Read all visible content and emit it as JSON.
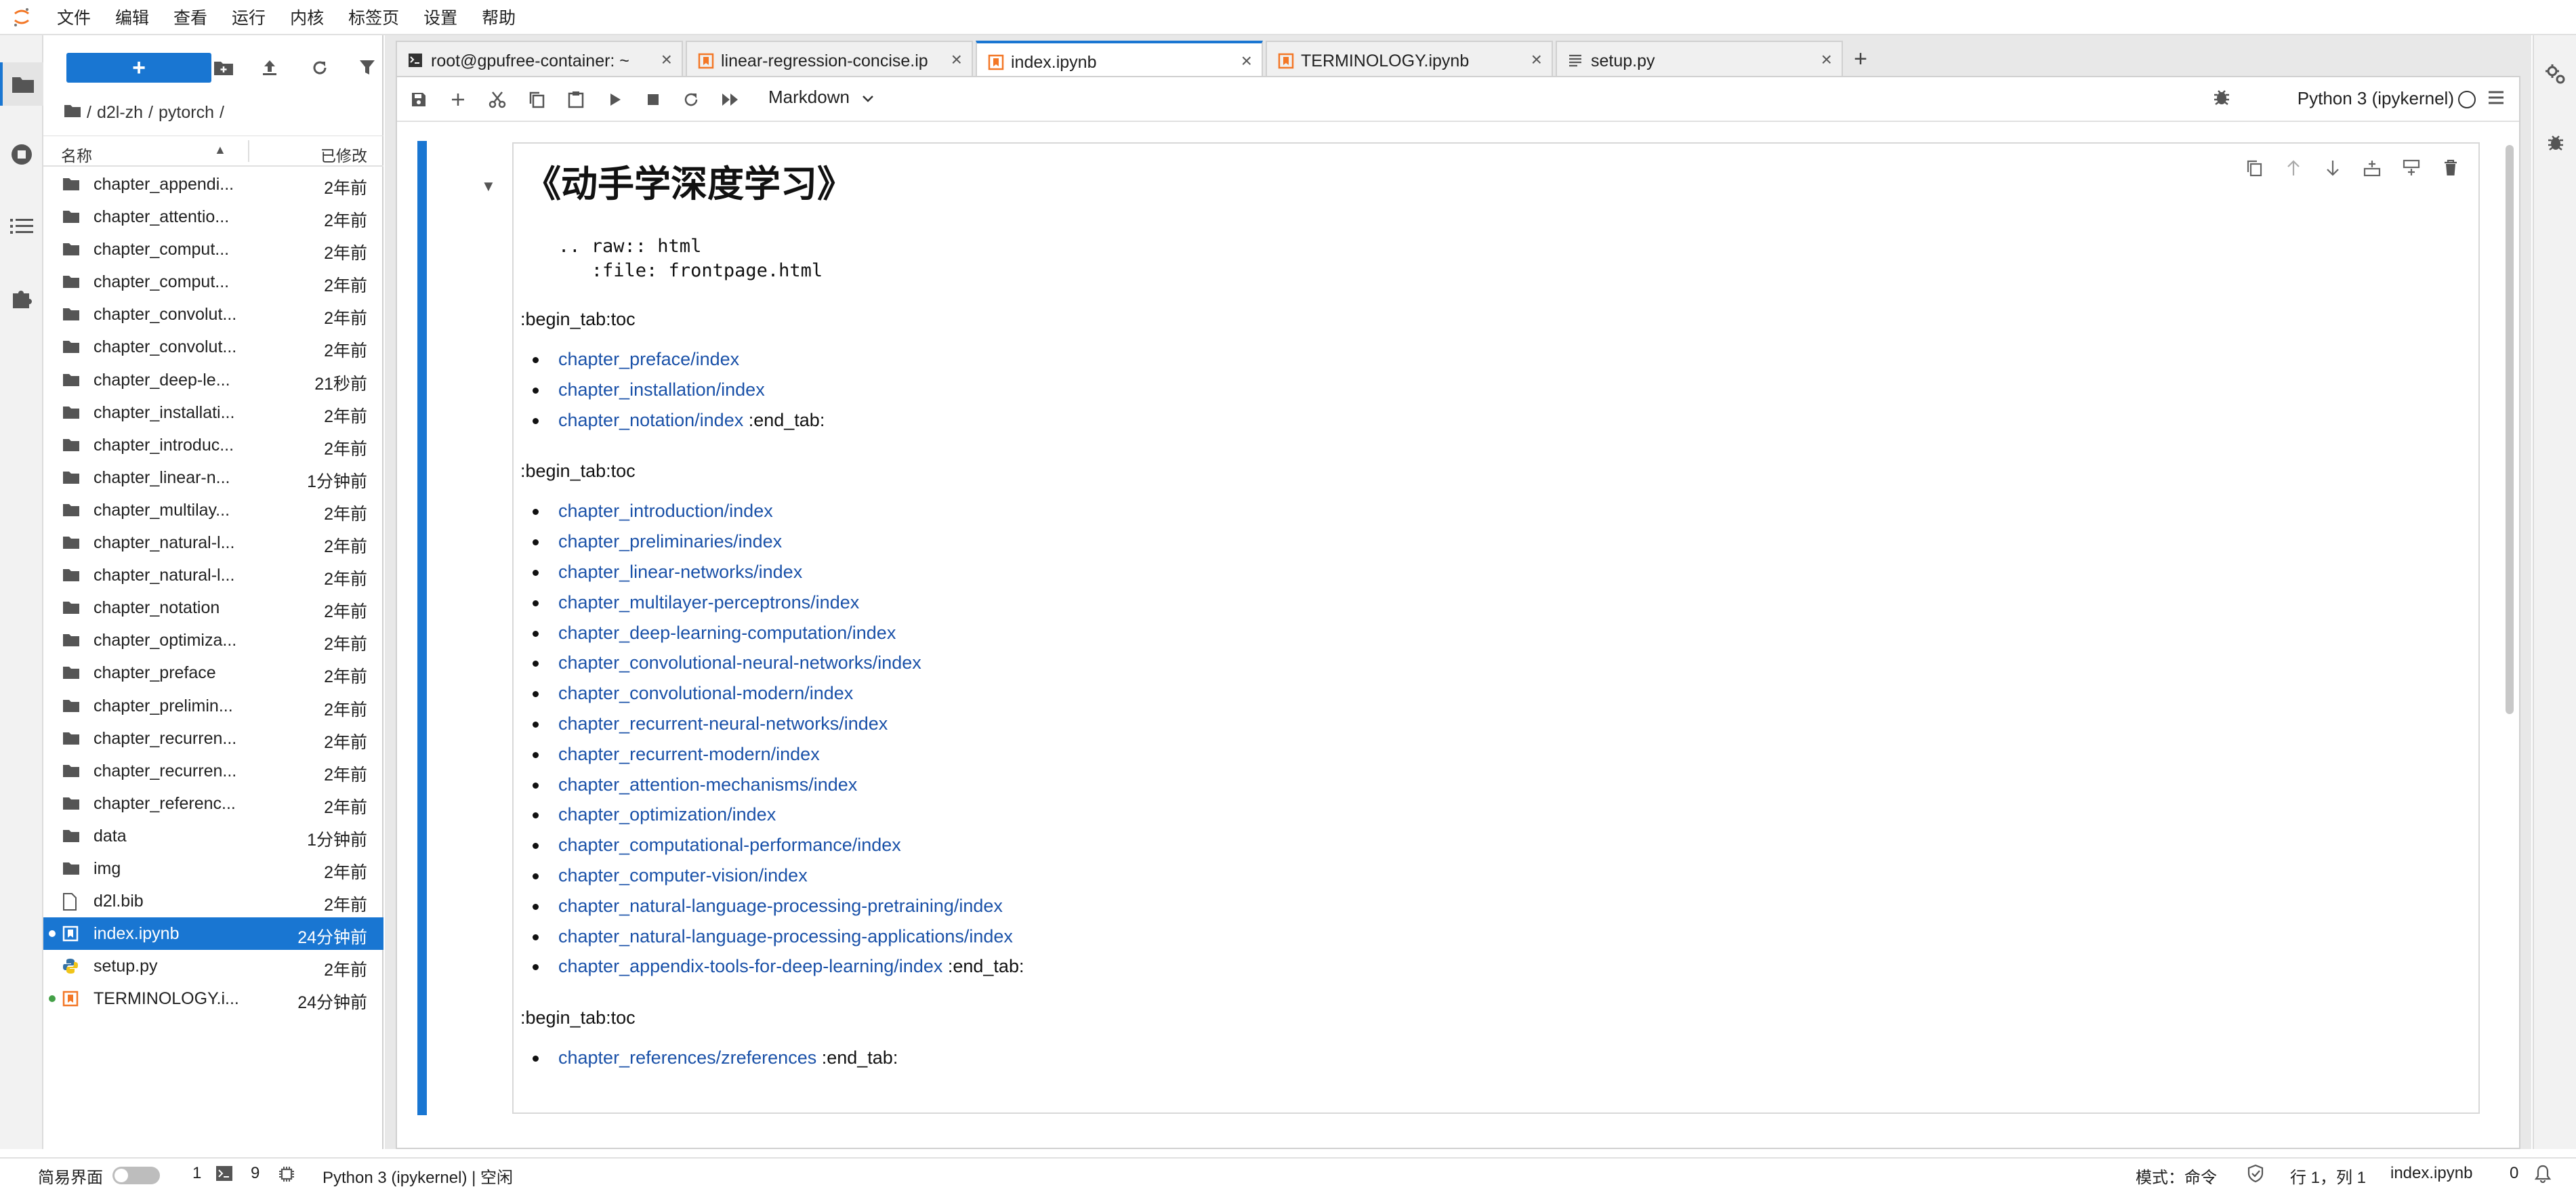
{
  "menubar": {
    "items": [
      "文件",
      "编辑",
      "查看",
      "运行",
      "内核",
      "标签页",
      "设置",
      "帮助"
    ]
  },
  "filebrowser": {
    "new_label": "+",
    "breadcrumb": [
      "/",
      "d2l-zh",
      "/",
      "pytorch",
      "/"
    ],
    "header": {
      "name": "名称",
      "modified": "已修改"
    },
    "files": [
      {
        "name": "chapter_appendi...",
        "modified": "2年前",
        "type": "folder"
      },
      {
        "name": "chapter_attentio...",
        "modified": "2年前",
        "type": "folder"
      },
      {
        "name": "chapter_comput...",
        "modified": "2年前",
        "type": "folder"
      },
      {
        "name": "chapter_comput...",
        "modified": "2年前",
        "type": "folder"
      },
      {
        "name": "chapter_convolut...",
        "modified": "2年前",
        "type": "folder"
      },
      {
        "name": "chapter_convolut...",
        "modified": "2年前",
        "type": "folder"
      },
      {
        "name": "chapter_deep-le...",
        "modified": "21秒前",
        "type": "folder"
      },
      {
        "name": "chapter_installati...",
        "modified": "2年前",
        "type": "folder"
      },
      {
        "name": "chapter_introduc...",
        "modified": "2年前",
        "type": "folder"
      },
      {
        "name": "chapter_linear-n...",
        "modified": "1分钟前",
        "type": "folder"
      },
      {
        "name": "chapter_multilay...",
        "modified": "2年前",
        "type": "folder"
      },
      {
        "name": "chapter_natural-l...",
        "modified": "2年前",
        "type": "folder"
      },
      {
        "name": "chapter_natural-l...",
        "modified": "2年前",
        "type": "folder"
      },
      {
        "name": "chapter_notation",
        "modified": "2年前",
        "type": "folder"
      },
      {
        "name": "chapter_optimiza...",
        "modified": "2年前",
        "type": "folder"
      },
      {
        "name": "chapter_preface",
        "modified": "2年前",
        "type": "folder"
      },
      {
        "name": "chapter_prelimin...",
        "modified": "2年前",
        "type": "folder"
      },
      {
        "name": "chapter_recurren...",
        "modified": "2年前",
        "type": "folder"
      },
      {
        "name": "chapter_recurren...",
        "modified": "2年前",
        "type": "folder"
      },
      {
        "name": "chapter_referenc...",
        "modified": "2年前",
        "type": "folder"
      },
      {
        "name": "data",
        "modified": "1分钟前",
        "type": "folder"
      },
      {
        "name": "img",
        "modified": "2年前",
        "type": "folder"
      },
      {
        "name": "d2l.bib",
        "modified": "2年前",
        "type": "file"
      },
      {
        "name": "index.ipynb",
        "modified": "24分钟前",
        "type": "notebook",
        "selected": true,
        "dot": "#ffffff"
      },
      {
        "name": "setup.py",
        "modified": "2年前",
        "type": "python"
      },
      {
        "name": "TERMINOLOGY.i...",
        "modified": "24分钟前",
        "type": "notebook",
        "dot": "#43a047"
      }
    ]
  },
  "tabs": [
    {
      "label": "root@gpufree-container: ~",
      "type": "terminal",
      "active": false
    },
    {
      "label": "linear-regression-concise.ip",
      "type": "notebook",
      "active": false
    },
    {
      "label": "index.ipynb",
      "type": "notebook",
      "active": true
    },
    {
      "label": "TERMINOLOGY.ipynb",
      "type": "notebook",
      "active": false
    },
    {
      "label": "setup.py",
      "type": "text",
      "active": false
    }
  ],
  "toolbar": {
    "cell_type": "Markdown",
    "kernel": "Python 3 (ipykernel)"
  },
  "cell": {
    "title": "《动手学深度学习》",
    "code": ".. raw:: html\n   :file: frontpage.html",
    "toc1_begin": ":begin_tab:toc",
    "toc1": [
      "chapter_preface/index",
      "chapter_installation/index",
      "chapter_notation/index"
    ],
    "toc1_end": " :end_tab:",
    "toc2_begin": ":begin_tab:toc",
    "toc2": [
      "chapter_introduction/index",
      "chapter_preliminaries/index",
      "chapter_linear-networks/index",
      "chapter_multilayer-perceptrons/index",
      "chapter_deep-learning-computation/index",
      "chapter_convolutional-neural-networks/index",
      "chapter_convolutional-modern/index",
      "chapter_recurrent-neural-networks/index",
      "chapter_recurrent-modern/index",
      "chapter_attention-mechanisms/index",
      "chapter_optimization/index",
      "chapter_computational-performance/index",
      "chapter_computer-vision/index",
      "chapter_natural-language-processing-pretraining/index",
      "chapter_natural-language-processing-applications/index",
      "chapter_appendix-tools-for-deep-learning/index"
    ],
    "toc2_end": " :end_tab:",
    "toc3_begin": ":begin_tab:toc",
    "toc3": [
      "chapter_references/zreferences"
    ],
    "toc3_end": " :end_tab:"
  },
  "statusbar": {
    "simple_mode": "简易界面",
    "count1": "1",
    "count2": "9",
    "kernel_status": "Python 3 (ipykernel) | 空闲",
    "mode": "模式：命令",
    "position": "行 1，列 1",
    "filename": "index.ipynb",
    "notifications": "0"
  },
  "colors": {
    "accent": "#1976d2",
    "link": "#1a51a8",
    "notebook_icon": "#f37726"
  }
}
